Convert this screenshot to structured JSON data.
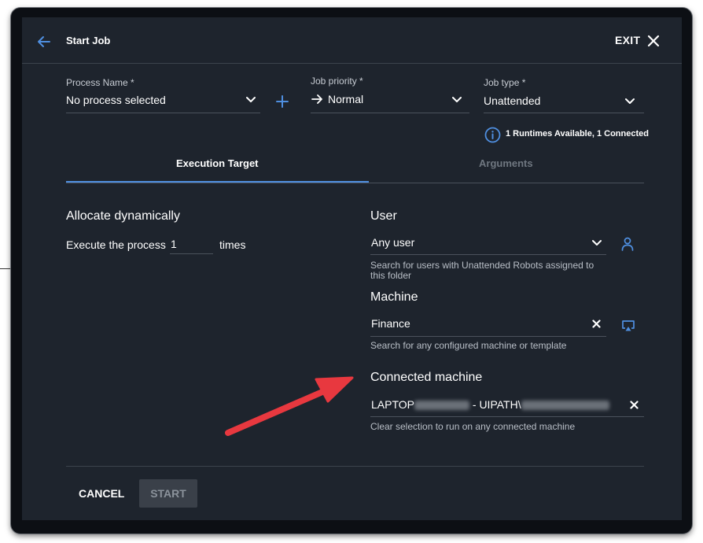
{
  "header": {
    "title": "Start Job",
    "exit_label": "EXIT"
  },
  "form": {
    "process_name": {
      "label": "Process Name *",
      "value": "No process selected"
    },
    "job_priority": {
      "label": "Job priority *",
      "value": "Normal"
    },
    "job_type": {
      "label": "Job type *",
      "value": "Unattended"
    },
    "runtimes_info": "1 Runtimes Available, 1 Connected"
  },
  "tabs": [
    {
      "label": "Execution Target",
      "active": true
    },
    {
      "label": "Arguments",
      "active": false
    }
  ],
  "allocation": {
    "heading": "Allocate dynamically",
    "execute_prefix": "Execute the process",
    "times_value": "1",
    "execute_suffix": "times"
  },
  "user": {
    "heading": "User",
    "value": "Any user",
    "help": "Search for users with Unattended Robots assigned to this folder"
  },
  "machine": {
    "heading": "Machine",
    "value": "Finance",
    "help": "Search for any configured machine or template"
  },
  "connected_machine": {
    "heading": "Connected machine",
    "value_prefix": "LAPTOP",
    "value_middle": " - UIPATH\\",
    "help": "Clear selection to run on any connected machine"
  },
  "footer": {
    "cancel_label": "CANCEL",
    "start_label": "START"
  },
  "colors": {
    "accent": "#4f8fe0",
    "annotation_arrow": "#e8383f",
    "dialog_bg": "#1e242d"
  },
  "icons": [
    "back-arrow-icon",
    "close-icon",
    "plus-icon",
    "chevron-down-icon",
    "arrow-right-icon",
    "info-icon",
    "person-icon",
    "clear-icon",
    "cast-icon"
  ]
}
